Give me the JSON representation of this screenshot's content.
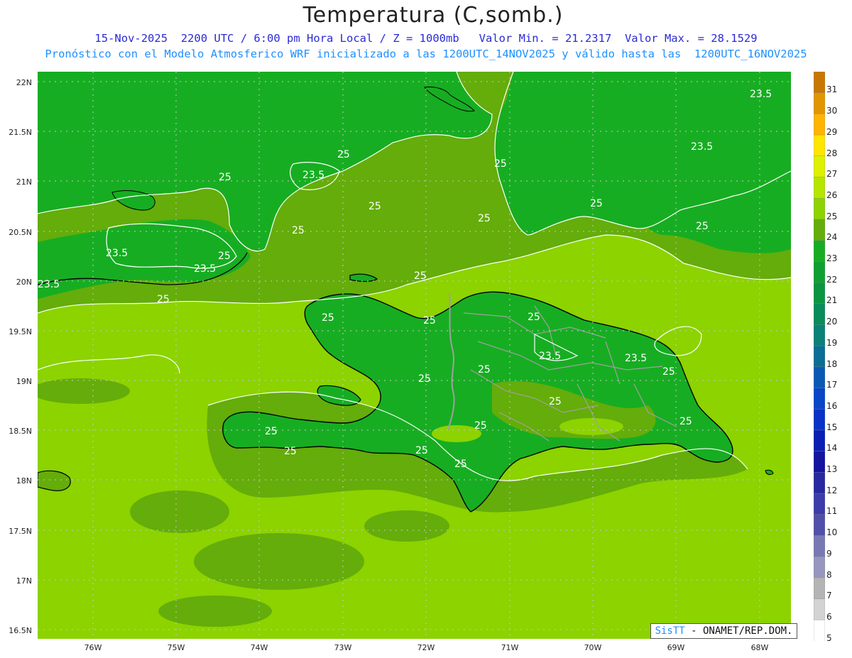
{
  "header": {
    "title": "Temperatura (C,somb.)",
    "subtitle_line1": "15-Nov-2025  2200 UTC / 6:00 pm Hora Local / Z = 1000mb   Valor Min. = 21.2317  Valor Max. = 28.1529",
    "subtitle_line2": "Pronóstico con el Modelo Atmosferico WRF inicializado a las 1200UTC_14NOV2025 y válido hasta las  1200UTC_16NOV2025"
  },
  "axes": {
    "lat_labels": [
      "22N",
      "21.5N",
      "21N",
      "20.5N",
      "20N",
      "19.5N",
      "19N",
      "18.5N",
      "18N",
      "17.5N",
      "17N",
      "16.5N"
    ],
    "lon_labels": [
      "76W",
      "75W",
      "74W",
      "73W",
      "72W",
      "71W",
      "70W",
      "69W",
      "68W"
    ]
  },
  "map": {
    "contour_labels": [
      "25",
      "23.5"
    ],
    "colors": {
      "fill_24": "#17ad22",
      "fill_25": "#64ad0a",
      "fill_26": "#8cd300",
      "contour": "#ffffff",
      "coast": "#000000",
      "border": "#a0a0a0",
      "grid": "#c8c8c8"
    }
  },
  "colorbar": {
    "labels": [
      "31",
      "30",
      "29",
      "28",
      "27",
      "26",
      "25",
      "24",
      "23",
      "22",
      "21",
      "20",
      "19",
      "18",
      "17",
      "16",
      "15",
      "14",
      "13",
      "12",
      "11",
      "10",
      "9",
      "8",
      "7",
      "6",
      "5"
    ],
    "colors": [
      "#c87800",
      "#e09600",
      "#ffb400",
      "#ffe600",
      "#dcf000",
      "#b4e600",
      "#8cd300",
      "#64ad0a",
      "#17ad22",
      "#10a032",
      "#0a9641",
      "#0a8c5a",
      "#0a8278",
      "#0a6e96",
      "#0a5ab4",
      "#0a46c8",
      "#0a32c8",
      "#0a1eb4",
      "#1414a0",
      "#2828a0",
      "#3c3caa",
      "#5050aa",
      "#7878b4",
      "#9696be",
      "#b4b4b4",
      "#d2d2d2",
      "#ffffff"
    ]
  },
  "credit": {
    "brand": "SisTT",
    "text": " - ONAMET/REP.DOM."
  }
}
